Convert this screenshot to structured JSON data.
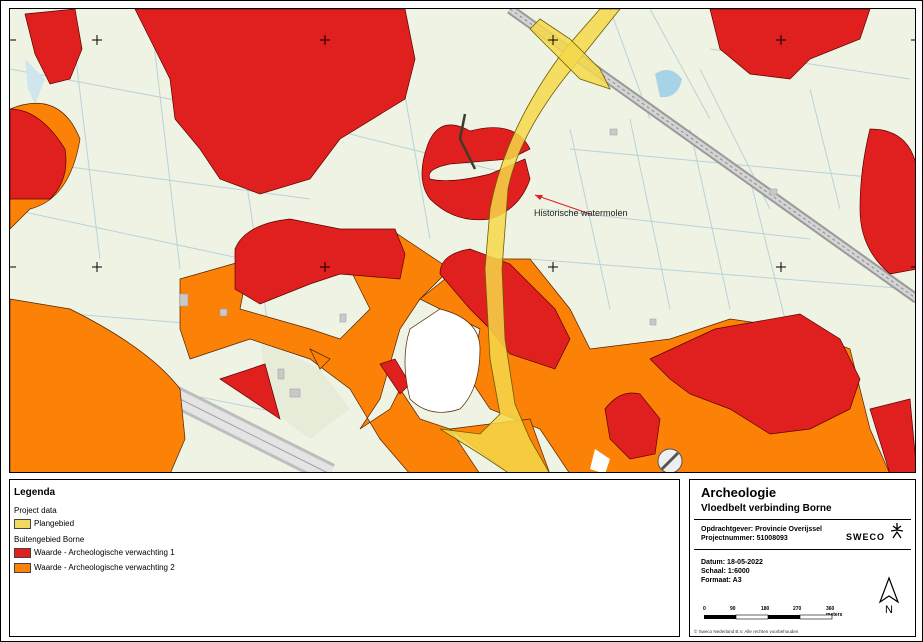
{
  "map": {
    "annotation": "Historische watermolen",
    "colors": {
      "background": "#eef3e4",
      "field_line": "#b9d3d8",
      "rail": "#9a9a9a",
      "road": "#d9d9d9",
      "value1": "#e0201f",
      "value2": "#fb8206",
      "plangebied": "#f4d84a",
      "annotation_arrow": "#e02020"
    }
  },
  "legend": {
    "title": "Legenda",
    "sections": [
      {
        "heading": "Project data",
        "items": [
          {
            "label": "Plangebied",
            "color": "#f2d95f"
          }
        ]
      },
      {
        "heading": "Buitengebied Borne",
        "items": [
          {
            "label": "Waarde - Archeologische verwachting 1",
            "color": "#e0201f"
          },
          {
            "label": "Waarde - Archeologische verwachting 2",
            "color": "#fb8206"
          }
        ]
      }
    ]
  },
  "titleblock": {
    "title": "Archeologie",
    "subtitle": "Vloedbelt verbinding Borne",
    "client": "Opdrachtgever: Provincie Overijssel",
    "project_number": "Projectnummer: 51008093",
    "date": "Datum: 18-05-2022",
    "scale": "Schaal: 1:6000",
    "format": "Formaat: A3",
    "logo_text": "SWECO",
    "north_label": "N",
    "scale_ticks": [
      "0",
      "90",
      "180",
      "270",
      "360 meters"
    ],
    "copyright": "© Sweco Nederland B.V. Alle rechten voorbehouden"
  }
}
